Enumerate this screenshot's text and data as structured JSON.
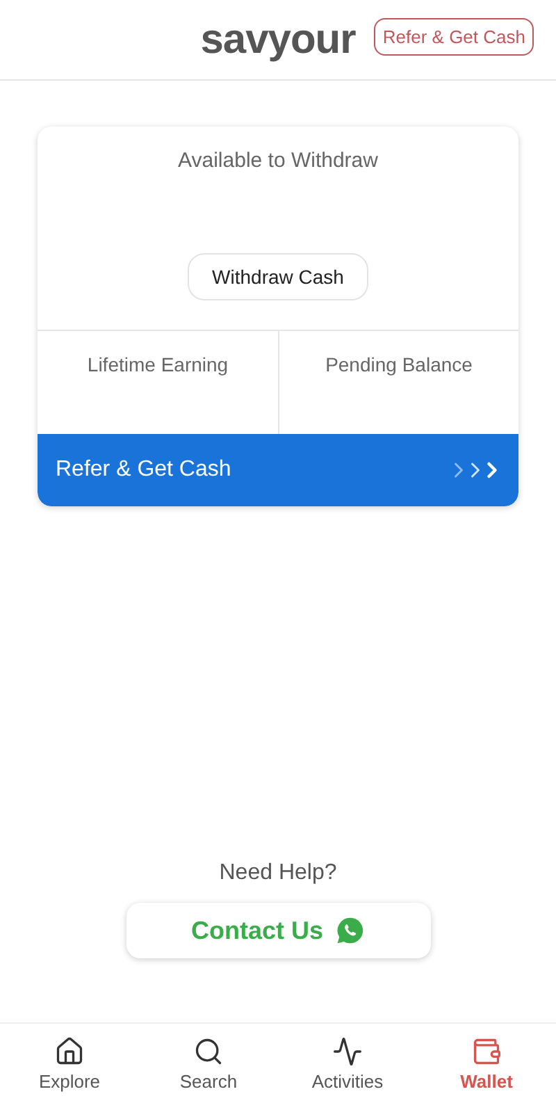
{
  "header": {
    "logo": "savyour",
    "refer_button": "Refer & Get Cash"
  },
  "wallet_card": {
    "available_label": "Available to Withdraw",
    "withdraw_button": "Withdraw Cash",
    "lifetime_label": "Lifetime Earning",
    "pending_label": "Pending Balance",
    "refer_banner": "Refer & Get Cash"
  },
  "help": {
    "title": "Need Help?",
    "contact_button": "Contact Us"
  },
  "nav": [
    {
      "label": "Explore",
      "selected": false
    },
    {
      "label": "Search",
      "selected": false
    },
    {
      "label": "Activities",
      "selected": false
    },
    {
      "label": "Wallet",
      "selected": true
    }
  ]
}
